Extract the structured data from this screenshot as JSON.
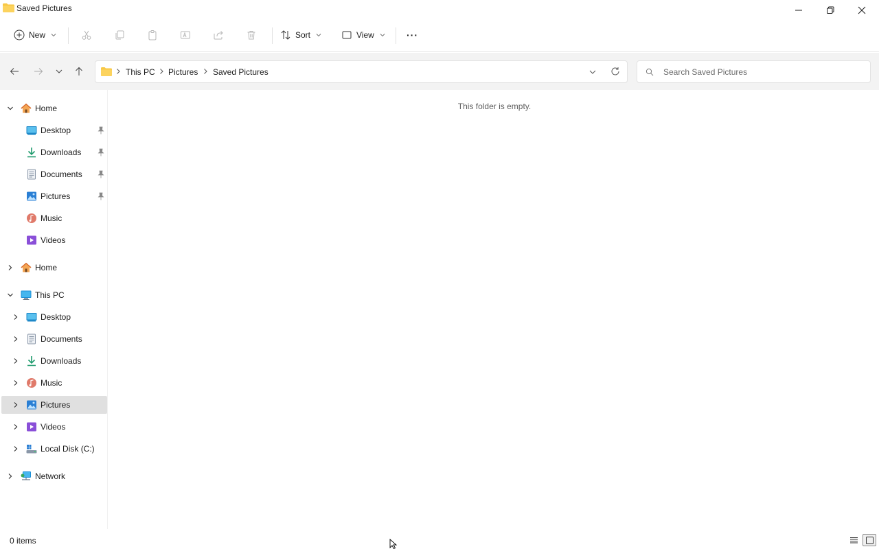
{
  "window": {
    "title": "Saved Pictures"
  },
  "toolbar": {
    "new_label": "New",
    "sort_label": "Sort",
    "view_label": "View",
    "more_label": "···"
  },
  "address": {
    "crumbs": [
      "This PC",
      "Pictures",
      "Saved Pictures"
    ]
  },
  "search": {
    "placeholder": "Search Saved Pictures"
  },
  "sidebar": {
    "quick_access": [
      {
        "label": "Home",
        "icon": "home-icon"
      },
      {
        "label": "Desktop",
        "icon": "desktop-icon",
        "pinned": true
      },
      {
        "label": "Downloads",
        "icon": "download-icon",
        "pinned": true
      },
      {
        "label": "Documents",
        "icon": "document-icon",
        "pinned": true
      },
      {
        "label": "Pictures",
        "icon": "pictures-icon",
        "pinned": true
      },
      {
        "label": "Music",
        "icon": "music-icon"
      },
      {
        "label": "Videos",
        "icon": "videos-icon"
      }
    ],
    "home2": {
      "label": "Home",
      "icon": "home-icon"
    },
    "this_pc": {
      "label": "This PC",
      "icon": "pc-icon"
    },
    "this_pc_items": [
      {
        "label": "Desktop",
        "icon": "desktop-icon"
      },
      {
        "label": "Documents",
        "icon": "document-icon"
      },
      {
        "label": "Downloads",
        "icon": "download-icon"
      },
      {
        "label": "Music",
        "icon": "music-icon"
      },
      {
        "label": "Pictures",
        "icon": "pictures-icon",
        "selected": true
      },
      {
        "label": "Videos",
        "icon": "videos-icon"
      },
      {
        "label": "Local Disk (C:)",
        "icon": "drive-icon"
      }
    ],
    "network": {
      "label": "Network",
      "icon": "network-icon"
    }
  },
  "main": {
    "empty_message": "This folder is empty."
  },
  "status": {
    "item_count": "0 items"
  },
  "colors": {
    "folder": "#f8c846",
    "selected": "#e0e0e0",
    "accent": "#0067c0"
  }
}
